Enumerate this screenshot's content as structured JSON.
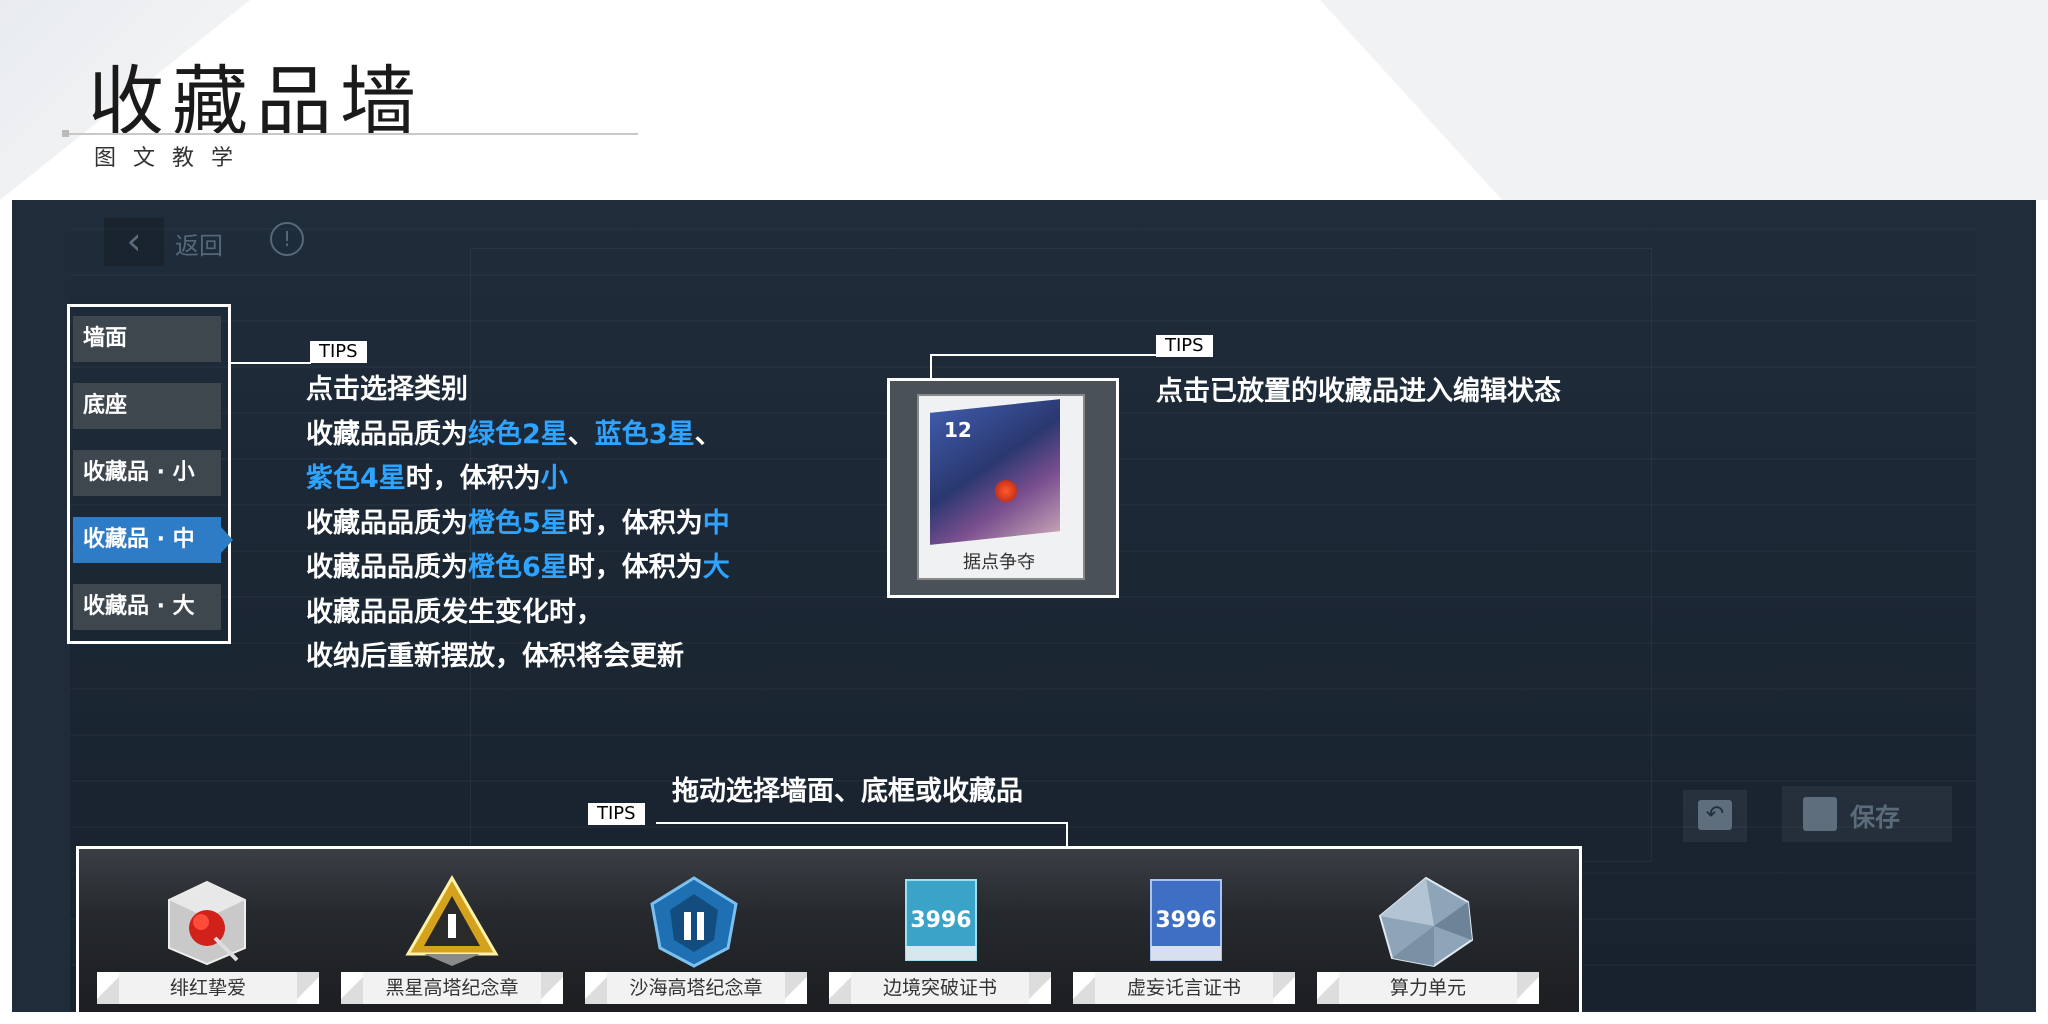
{
  "header": {
    "title": "收藏品墙",
    "subtitle": "图文教学"
  },
  "game": {
    "back_label": "返回",
    "info_icon": "!",
    "categories": [
      {
        "label": "墙面",
        "active": false
      },
      {
        "label": "底座",
        "active": false
      },
      {
        "label": "收藏品 · 小",
        "active": false
      },
      {
        "label": "收藏品 · 中",
        "active": true
      },
      {
        "label": "收藏品 · 大",
        "active": false
      }
    ],
    "save_label": "保存",
    "card": {
      "label": "据点争夺",
      "number": "12"
    },
    "items": [
      {
        "name": "绯红挚爱",
        "icon": "red-rose-cube-icon"
      },
      {
        "name": "黑星高塔纪念章",
        "icon": "gold-triangle-badge-icon"
      },
      {
        "name": "沙海高塔纪念章",
        "icon": "blue-shield-badge-icon"
      },
      {
        "name": "边境突破证书",
        "icon": "certificate-icon",
        "value": "3996"
      },
      {
        "name": "虚妄讬言证书",
        "icon": "certificate-icon",
        "value": "3996"
      },
      {
        "name": "算力单元",
        "icon": "crystal-polyhedron-icon"
      }
    ]
  },
  "tips": {
    "badge": "TIPS",
    "category_lines": {
      "l1": "点击选择类别",
      "l2a": "收藏品品质为",
      "l2b": "绿色2星",
      "l2c": "、",
      "l2d": "蓝色3星",
      "l2e": "、",
      "l3a": "紫色4星",
      "l3b": "时，体积为",
      "l3c": "小",
      "l4a": "收藏品品质为",
      "l4b": "橙色5星",
      "l4c": "时，体积为",
      "l4d": "中",
      "l5a": "收藏品品质为",
      "l5b": "橙色6星",
      "l5c": "时，体积为",
      "l5d": "大",
      "l6": "收藏品品质发生变化时，",
      "l7": "收纳后重新摆放，体积将会更新"
    },
    "edit_text": "点击已放置的收藏品进入编辑状态",
    "drag_text": "拖动选择墙面、底框或收藏品"
  },
  "colors": {
    "highlight": "#2ea3ff",
    "active_category": "#2f7cc6",
    "panel_bg": "#1f2c3a"
  }
}
